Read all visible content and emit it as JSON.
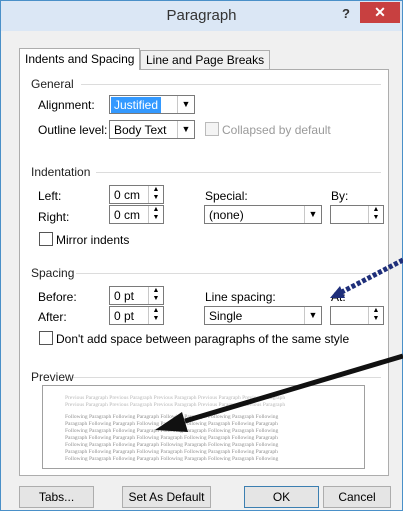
{
  "dialog": {
    "title": "Paragraph",
    "help_label": "?",
    "close_label": "✕"
  },
  "tabs": [
    {
      "label": "Indents and Spacing",
      "active": true
    },
    {
      "label": "Line and Page Breaks",
      "active": false
    }
  ],
  "general": {
    "heading": "General",
    "alignment_label": "Alignment:",
    "alignment_value": "Justified",
    "outline_label": "Outline level:",
    "outline_value": "Body Text",
    "collapsed_label": "Collapsed by default",
    "collapsed_checked": false
  },
  "indentation": {
    "heading": "Indentation",
    "left_label": "Left:",
    "left_value": "0 cm",
    "right_label": "Right:",
    "right_value": "0 cm",
    "special_label": "Special:",
    "special_value": "(none)",
    "by_label": "By:",
    "by_value": "",
    "mirror_label": "Mirror indents",
    "mirror_checked": false
  },
  "spacing": {
    "heading": "Spacing",
    "before_label": "Before:",
    "before_value": "0 pt",
    "after_label": "After:",
    "after_value": "0 pt",
    "line_spacing_label": "Line spacing:",
    "line_spacing_value": "Single",
    "at_label": "At:",
    "at_value": "",
    "dont_add_label": "Don't add space between paragraphs of the same style",
    "dont_add_checked": false
  },
  "preview": {
    "heading": "Preview",
    "prev_lines": [
      "Previous Paragraph Previous Paragraph Previous Paragraph Previous Paragraph Previous Paragraph",
      "Previous Paragraph Previous Paragraph Previous Paragraph Previous Paragraph Previous Paragraph"
    ],
    "body_lines": [
      "Following Paragraph Following Paragraph Following Paragraph Following Paragraph Following",
      "Paragraph Following Paragraph Following Paragraph Following Paragraph Following Paragraph",
      "Following Paragraph Following Paragraph Following Paragraph Following Paragraph Following",
      "Paragraph Following Paragraph Following Paragraph Following Paragraph Following Paragraph",
      "Following Paragraph Following Paragraph Following Paragraph Following Paragraph Following",
      "Paragraph Following Paragraph Following Paragraph Following Paragraph Following Paragraph",
      "Following Paragraph Following Paragraph Following Paragraph Following Paragraph Following"
    ]
  },
  "buttons": {
    "tabs_label": "Tabs...",
    "set_default_label": "Set As Default",
    "ok_label": "OK",
    "cancel_label": "Cancel"
  },
  "colors": {
    "accent": "#3399ff",
    "close": "#c84040",
    "title_bar": "#dbe7f5"
  }
}
